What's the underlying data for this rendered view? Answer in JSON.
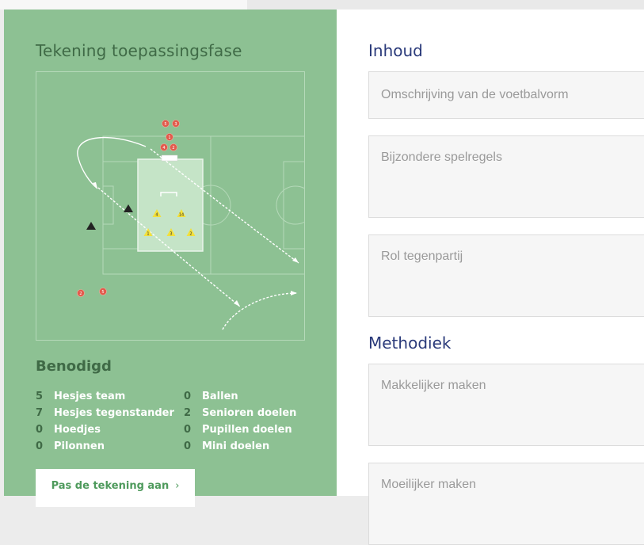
{
  "drawing": {
    "title": "Tekening toepassingsfase",
    "player_labels": {
      "team": [
        "4",
        "14",
        "1",
        "3",
        "2"
      ],
      "opponent": [
        "5",
        "3",
        "1",
        "4",
        "2",
        "2",
        "5"
      ]
    }
  },
  "equipment": {
    "title": "Benodigd",
    "left": [
      {
        "count": "5",
        "label": "Hesjes team"
      },
      {
        "count": "7",
        "label": "Hesjes tegenstander"
      },
      {
        "count": "0",
        "label": "Hoedjes"
      },
      {
        "count": "0",
        "label": "Pilonnen"
      }
    ],
    "right": [
      {
        "count": "0",
        "label": "Ballen"
      },
      {
        "count": "2",
        "label": "Senioren doelen"
      },
      {
        "count": "0",
        "label": "Pupillen doelen"
      },
      {
        "count": "0",
        "label": "Mini doelen"
      }
    ]
  },
  "edit_button": {
    "label": "Pas de tekening aan",
    "chevron": "›"
  },
  "content": {
    "title": "Inhoud",
    "fields": [
      {
        "placeholder": "Omschrijving van de voetbalvorm"
      },
      {
        "placeholder": "Bijzondere spelregels"
      },
      {
        "placeholder": "Rol tegenpartij"
      }
    ]
  },
  "method": {
    "title": "Methodiek",
    "fields": [
      {
        "placeholder": "Makkelijker maken"
      },
      {
        "placeholder": "Moeilijker maken"
      }
    ]
  },
  "colors": {
    "panel_green": "#8dc193",
    "heading_dark_green": "#3f6a46",
    "heading_blue": "#2a3a7a",
    "player_yellow": "#f3e03a",
    "opponent_red": "#e25a4c"
  }
}
